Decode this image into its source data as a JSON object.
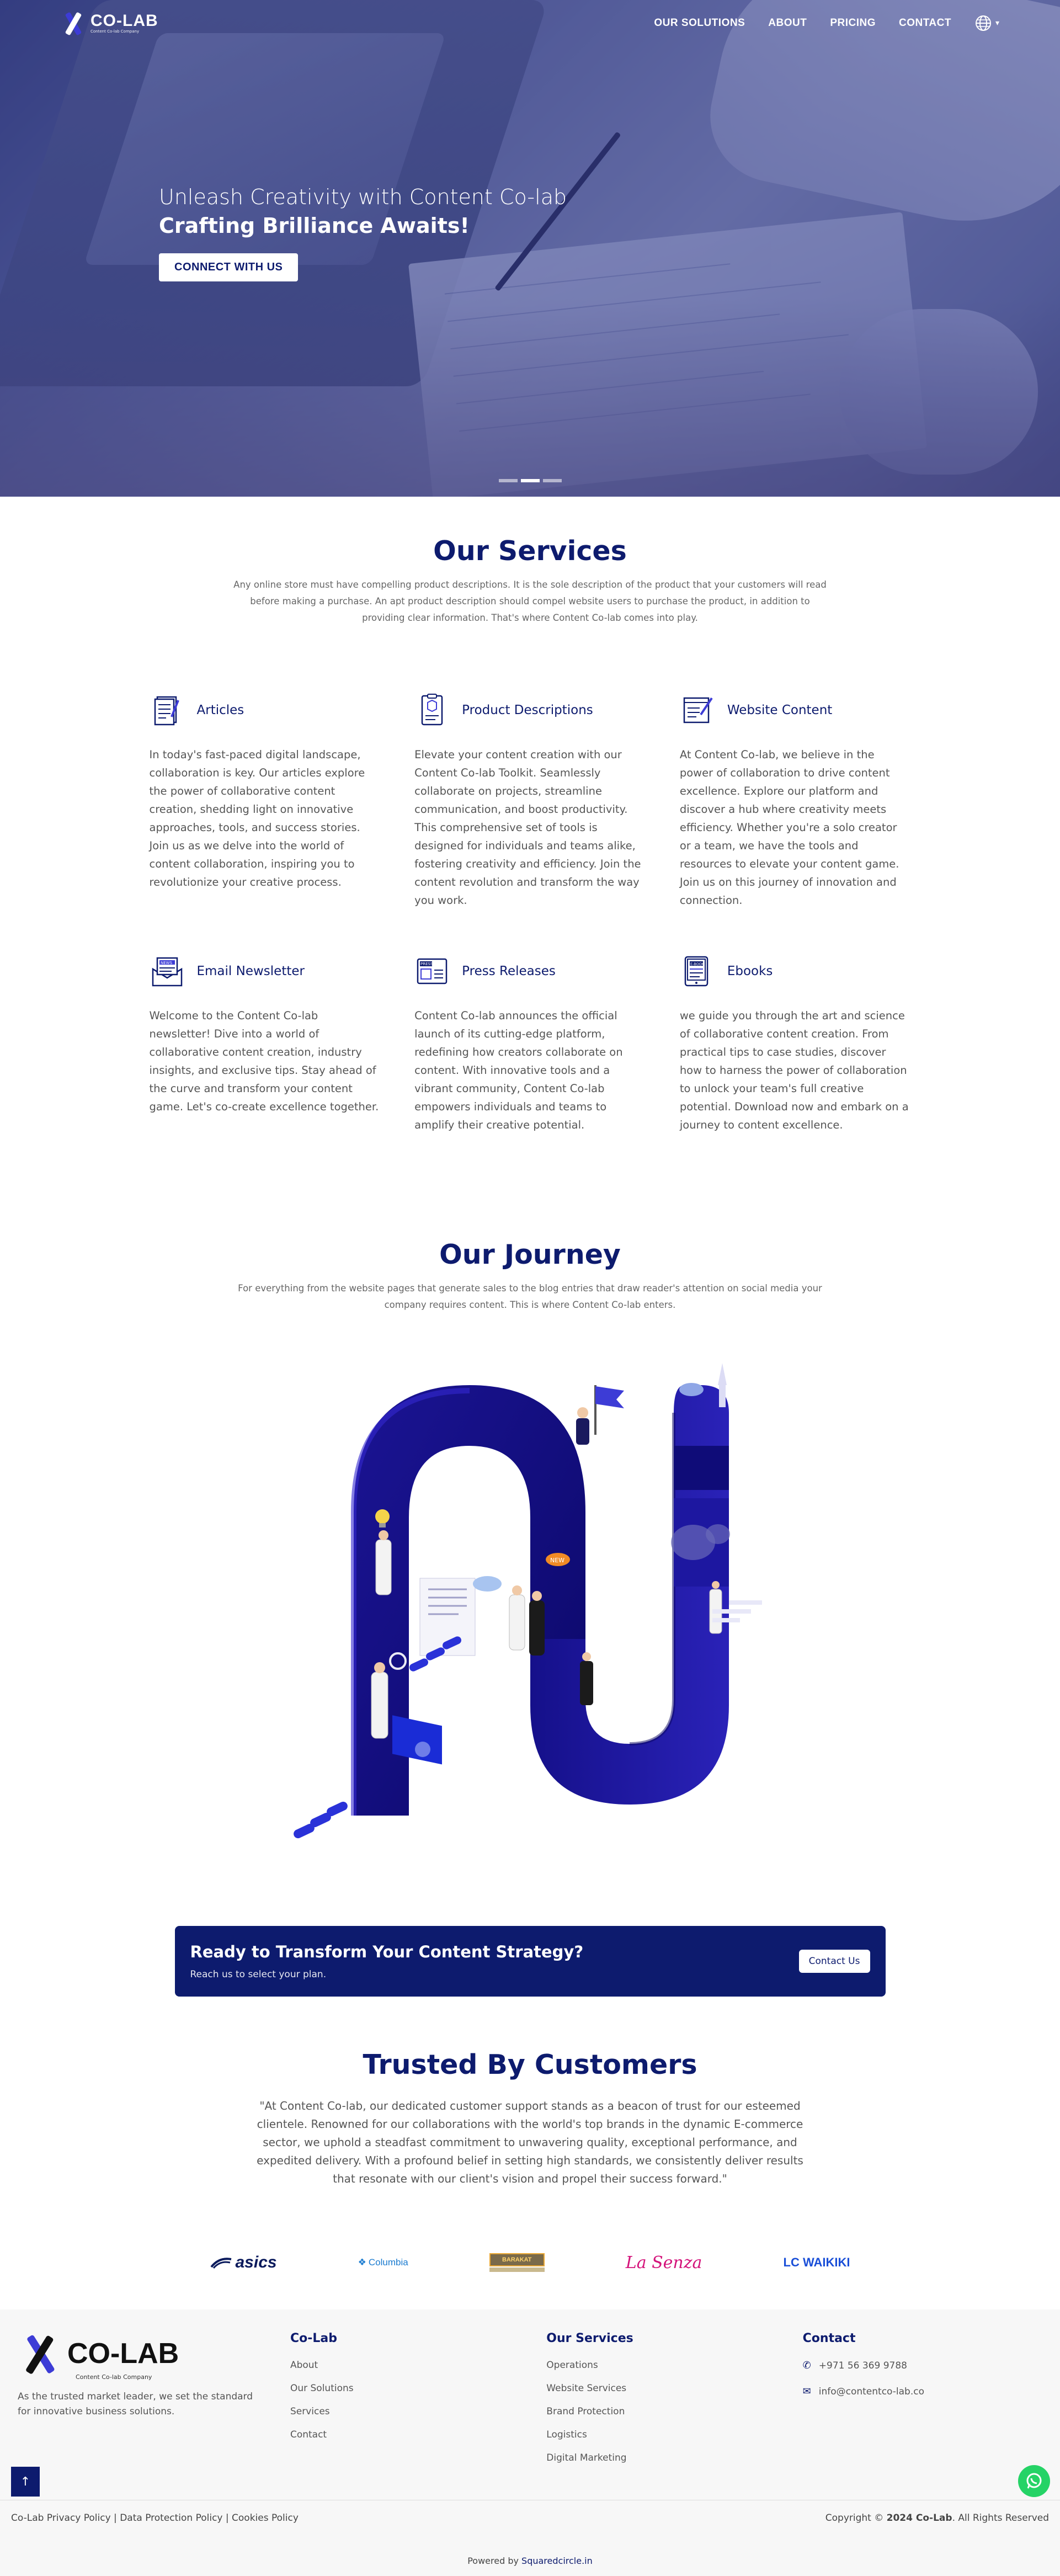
{
  "nav": {
    "logo_text": "CO-LAB",
    "logo_tagline": "Content Co-lab Company",
    "items": [
      {
        "label": "OUR SOLUTIONS"
      },
      {
        "label": "ABOUT"
      },
      {
        "label": "PRICING"
      },
      {
        "label": "CONTACT"
      }
    ]
  },
  "hero": {
    "line1": "Unleash Creativity with Content Co-lab",
    "line2": "Crafting Brilliance Awaits!",
    "cta": "CONNECT WITH US"
  },
  "services": {
    "title": "Our Services",
    "subtitle": "Any online store must have compelling product descriptions. It is the sole description of the product that your customers will read before making a purchase. An apt product description should compel website users to purchase the product, in addition to providing clear information. That's where Content Co-lab comes into play.",
    "items": [
      {
        "title": "Articles",
        "icon": "article-icon",
        "body": "In today's fast-paced digital landscape, collaboration is key. Our articles explore the power of collaborative content creation, shedding light on innovative approaches, tools, and success stories. Join us as we delve into the world of content collaboration, inspiring you to revolutionize your creative process."
      },
      {
        "title": "Product Descriptions",
        "icon": "product-description-icon",
        "body": "Elevate your content creation with our Content Co-lab Toolkit. Seamlessly collaborate on projects, streamline communication, and boost productivity. This comprehensive set of tools is designed for individuals and teams alike, fostering creativity and efficiency. Join the content revolution and transform the way you work."
      },
      {
        "title": "Website Content",
        "icon": "website-content-icon",
        "body": "At Content Co-lab, we believe in the power of collaboration to drive content excellence. Explore our platform and discover a hub where creativity meets efficiency. Whether you're a solo creator or a team, we have the tools and resources to elevate your content game. Join us on this journey of innovation and connection."
      },
      {
        "title": "Email Newsletter",
        "icon": "newsletter-icon",
        "body": "Welcome to the Content Co-lab newsletter! Dive into a world of collaborative content creation, industry insights, and exclusive tips. Stay ahead of the curve and transform your content game. Let's co-create excellence together."
      },
      {
        "title": "Press Releases",
        "icon": "press-release-icon",
        "body": "Content Co-lab announces the official launch of its cutting-edge platform, redefining how creators collaborate on content. With innovative tools and a vibrant community, Content Co-lab empowers individuals and teams to amplify their creative potential."
      },
      {
        "title": "Ebooks",
        "icon": "ebook-icon",
        "body": "we guide you through the art and science of collaborative content creation. From practical tips to case studies, discover how to harness the power of collaboration to unlock your team's full creative potential. Download now and embark on a journey to content excellence."
      }
    ]
  },
  "journey": {
    "title": "Our Journey",
    "subtitle": "For everything from the website pages that generate sales to the blog entries that draw reader's attention on social media your company requires content. This is where Content Co-lab enters."
  },
  "cta": {
    "heading": "Ready to Transform Your Content Strategy?",
    "sub": "Reach us to select your plan.",
    "button": "Contact Us"
  },
  "trusted": {
    "title": "Trusted By Customers",
    "quote": "\"At Content Co-lab, our dedicated customer support stands as a beacon of trust for our esteemed clientele. Renowned for our collaborations with the world's top brands in the dynamic E-commerce sector, we uphold a steadfast commitment to unwavering quality, exceptional performance, and expedited delivery. With a profound belief in setting high standards, we consistently deliver results that resonate with our client's vision and propel their success forward.\"",
    "brands": [
      "asics",
      "Columbia",
      "BARAKAT",
      "La Senza",
      "LC WAIKIKI"
    ]
  },
  "footer": {
    "logo_text": "CO-LAB",
    "logo_tagline": "Content Co-lab Company",
    "description": "As the trusted market leader, we set the standard for innovative business solutions.",
    "col1": {
      "title": "Co-Lab",
      "links": [
        "About",
        "Our Solutions",
        "Services",
        "Contact"
      ]
    },
    "col2": {
      "title": "Our Services",
      "links": [
        "Operations",
        "Website Services",
        "Brand Protection",
        "Logistics",
        "Digital Marketing"
      ]
    },
    "col3": {
      "title": "Contact",
      "phone": "+971 56 369 9788",
      "email": "info@contentco-lab.co"
    },
    "policies": "Co-Lab Privacy Policy | Data Protection Policy | Cookies Policy",
    "copyright_prefix": "Copyright © ",
    "copyright_bold": "2024 Co-Lab",
    "copyright_suffix": ". All Rights Reserved",
    "powered_prefix": "Powered by ",
    "powered_link": "Squaredcircle.in"
  },
  "colors": {
    "primary": "#0d1b6e",
    "accent": "#3d3cd6",
    "whatsapp": "#25d366"
  }
}
